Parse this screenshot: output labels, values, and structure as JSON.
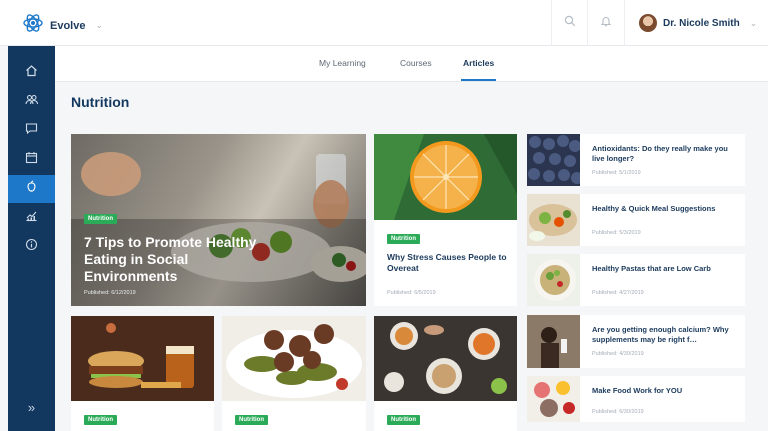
{
  "header": {
    "brand": "Evolve",
    "user_name": "Dr. Nicole Smith"
  },
  "tabs": [
    {
      "label": "My Learning",
      "active": false
    },
    {
      "label": "Courses",
      "active": false
    },
    {
      "label": "Articles",
      "active": true
    }
  ],
  "section_title": "Nutrition",
  "hero": {
    "badge": "Nutrition",
    "title": "7 Tips to Promote Healthy Eating in Social Environments",
    "date": "Published: 6/12/2019"
  },
  "feature": {
    "badge": "Nutrition",
    "title": "Why Stress Causes People to Overeat",
    "date": "Published: 6/5/2019"
  },
  "side_articles": [
    {
      "title": "Antioxidants: Do they really make you live longer?",
      "date": "Published: 5/1/2019"
    },
    {
      "title": "Healthy & Quick Meal Suggestions",
      "date": "Published: 5/3/2019"
    },
    {
      "title": "Healthy Pastas that are Low Carb",
      "date": "Published: 4/27/2019"
    },
    {
      "title": "Are you getting enough calcium? Why supplements may be right f…",
      "date": "Published: 4/30/2019"
    },
    {
      "title": "Make Food Work for YOU",
      "date": "Published: 6/30/2019"
    }
  ],
  "bottom_badges": [
    "Nutrition",
    "Nutrition",
    "Nutrition"
  ],
  "icons": {
    "logo": "evolve-logo-icon",
    "search": "search-icon",
    "bell": "bell-icon",
    "nav": [
      "home-icon",
      "users-icon",
      "chat-icon",
      "calendar-icon",
      "nutrition-icon",
      "chart-icon",
      "info-icon"
    ],
    "expand": "double-chevron-right-icon"
  },
  "colors": {
    "sidebar": "#13385f",
    "active_nav": "#1d78c9",
    "badge": "#2bab57",
    "title": "#1b3a5c"
  }
}
